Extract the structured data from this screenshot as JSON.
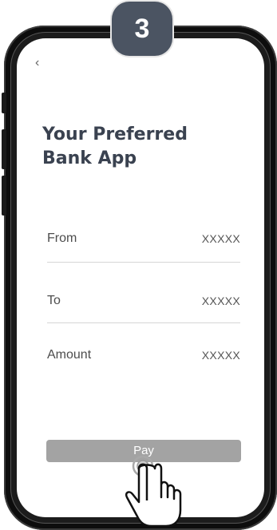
{
  "step": {
    "number": "3"
  },
  "screen": {
    "back_glyph": "‹",
    "title_line1": "Your Preferred",
    "title_line2": "Bank App",
    "fields": [
      {
        "label": "From",
        "value": "XXXXX"
      },
      {
        "label": "To",
        "value": "XXXXX"
      },
      {
        "label": "Amount",
        "value": "XXXXX"
      }
    ],
    "pay_label": "Pay"
  },
  "icons": {
    "back": "chevron-left-icon",
    "tap": "hand-pointer-tap-icon"
  },
  "colors": {
    "badge": "#4b5462",
    "title": "#3a4250",
    "pay_button": "#a3a3a3",
    "phone_frame": "#0d0d0d"
  }
}
